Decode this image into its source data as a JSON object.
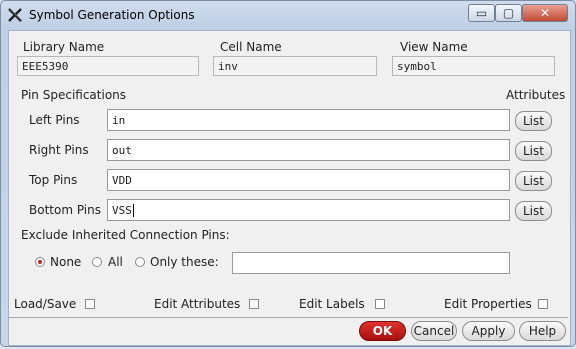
{
  "window": {
    "title": "Symbol Generation Options",
    "icon": "x-cadence-icon"
  },
  "window_controls": {
    "minimize": "▭",
    "maximize": "▢",
    "close": "✕"
  },
  "header": {
    "library_label": "Library Name",
    "library_value": "EEE5390",
    "cell_label": "Cell Name",
    "cell_value": "inv",
    "view_label": "View Name",
    "view_value": "symbol"
  },
  "pins": {
    "section_label": "Pin Specifications",
    "attributes_label": "Attributes",
    "rows": [
      {
        "label": "Left Pins",
        "value": "in",
        "button": "List"
      },
      {
        "label": "Right Pins",
        "value": "out",
        "button": "List"
      },
      {
        "label": "Top Pins",
        "value": "VDD",
        "button": "List"
      },
      {
        "label": "Bottom Pins",
        "value": "VSS",
        "button": "List"
      }
    ]
  },
  "exclude": {
    "label": "Exclude Inherited Connection Pins:",
    "options": [
      "None",
      "All",
      "Only these:"
    ],
    "selected": "None",
    "only_these_value": ""
  },
  "options": {
    "load_save": "Load/Save",
    "edit_attributes": "Edit Attributes",
    "edit_labels": "Edit Labels",
    "edit_properties": "Edit Properties"
  },
  "buttons": {
    "ok": "OK",
    "cancel": "Cancel",
    "apply": "Apply",
    "help": "Help"
  },
  "colors": {
    "ok_button": "#c0262a",
    "radio_selected": "#c0262a",
    "title_bar": "#c8d6e8"
  }
}
